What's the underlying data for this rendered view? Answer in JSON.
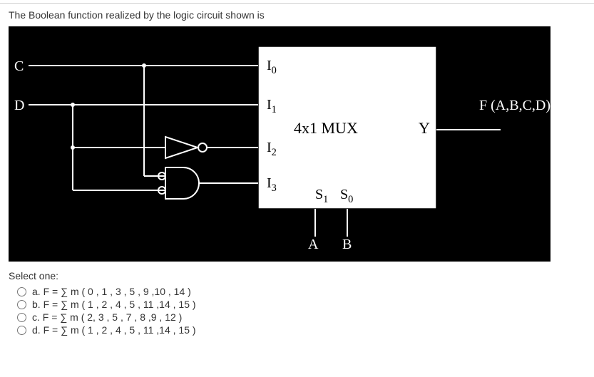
{
  "question": {
    "text": "The Boolean function realized by the logic circuit shown is"
  },
  "diagram": {
    "input_C": "C",
    "input_D": "D",
    "mux_inputs": {
      "i0": "I",
      "i0sub": "0",
      "i1": "I",
      "i1sub": "1",
      "i2": "I",
      "i2sub": "2",
      "i3": "I",
      "i3sub": "3"
    },
    "mux_name_a": "4x1 MUX",
    "mux_name_b": "Y",
    "sel1": "S",
    "sel1sub": "1",
    "sel0": "S",
    "sel0sub": "0",
    "A": "A",
    "B": "B",
    "output": "F (A,B,C,D)"
  },
  "answers": {
    "title": "Select one:",
    "options": [
      {
        "label": "a. F = ∑ m ( 0 , 1 , 3 , 5 , 9 ,10 , 14 )"
      },
      {
        "label": "b. F = ∑ m ( 1 , 2 , 4 , 5 , 11 ,14 , 15 )"
      },
      {
        "label": "c. F = ∑ m ( 2, 3 , 5 , 7 , 8 ,9 , 12 )"
      },
      {
        "label": "d. F = ∑ m ( 1 , 2 , 4 , 5 , 11 ,14 , 15 )"
      }
    ]
  }
}
